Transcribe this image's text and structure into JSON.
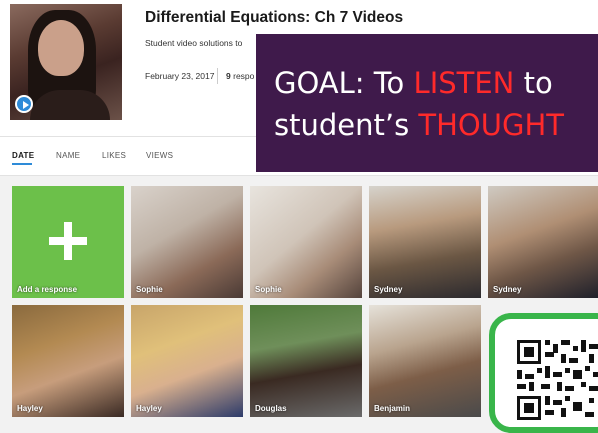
{
  "video": {
    "title": "Differential Equations: Ch 7 Videos",
    "description": "Student video solutions to",
    "date": "February 23, 2017",
    "response_count": "9",
    "response_word": "respo"
  },
  "sort": {
    "tabs": [
      {
        "label": "DATE",
        "active": true
      },
      {
        "label": "NAME",
        "active": false
      },
      {
        "label": "LIKES",
        "active": false
      },
      {
        "label": "VIEWS",
        "active": false
      }
    ],
    "accent": "#2e8bd8"
  },
  "grid": {
    "add_label": "Add a response",
    "add_color": "#6cc04a",
    "tiles": [
      {
        "name": "Sophie"
      },
      {
        "name": "Sophie"
      },
      {
        "name": "Sydney"
      },
      {
        "name": "Sydney"
      },
      {
        "name": "Hayley"
      },
      {
        "name": "Hayley"
      },
      {
        "name": "Douglas"
      },
      {
        "name": "Benjamin"
      }
    ]
  },
  "overlay": {
    "line1_prefix": "GOAL: To ",
    "line1_highlight": "LISTEN",
    "line1_suffix": " to",
    "line2_prefix": "student’s ",
    "line2_highlight": "THOUGHT",
    "background": "#3f1a4b",
    "highlight_color": "#ff2a2a"
  },
  "qr": {
    "frame_color": "#39b54a"
  }
}
